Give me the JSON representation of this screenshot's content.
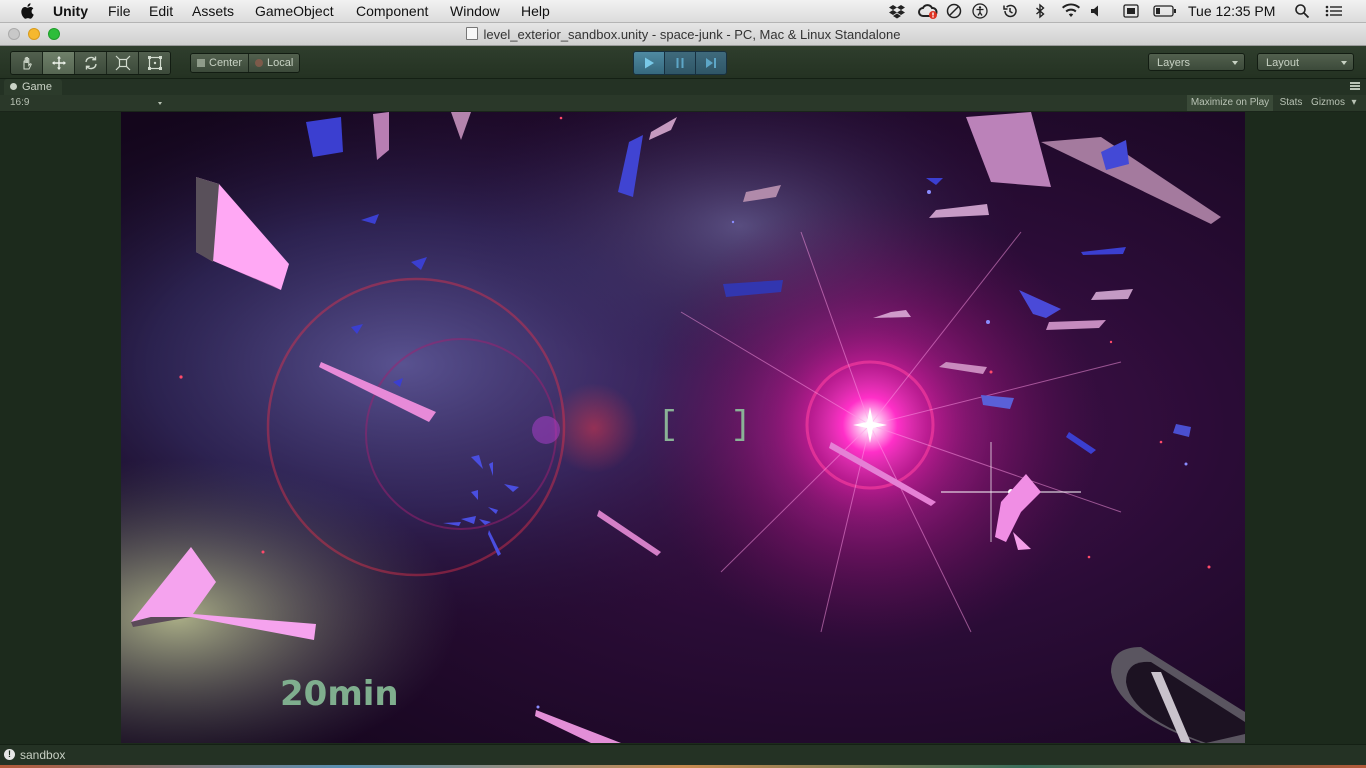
{
  "menubar": {
    "app_name": "Unity",
    "items": [
      "File",
      "Edit",
      "Assets",
      "GameObject",
      "Component",
      "Window",
      "Help"
    ],
    "status_icons": [
      "dropbox-icon",
      "creative-cloud-icon",
      "do-not-disturb-icon",
      "accessibility-icon",
      "time-machine-icon",
      "bluetooth-icon",
      "wifi-icon",
      "volume-icon",
      "input-source-icon",
      "battery-icon",
      "spotlight-search-icon",
      "notification-center-icon"
    ],
    "clock": "Tue 12:35 PM"
  },
  "window": {
    "title": "level_exterior_sandbox.unity - space-junk - PC, Mac & Linux Standalone"
  },
  "toolbar": {
    "transform_tools": [
      "hand-tool",
      "move-tool",
      "rotate-tool",
      "scale-tool",
      "rect-tool"
    ],
    "active_tool": "move-tool",
    "pivot_label": "Center",
    "space_label": "Local",
    "layers_label": "Layers",
    "layout_label": "Layout"
  },
  "game_panel": {
    "tab_label": "Game",
    "aspect": "16:9",
    "maximize_label": "Maximize on Play",
    "stats_label": "Stats",
    "gizmos_label": "Gizmos"
  },
  "hud": {
    "reticle": "[ ]",
    "timer": "20min"
  },
  "status": {
    "message": "sandbox"
  },
  "colors": {
    "unity_chrome": "#2f3e2d",
    "play_accent": "#3f6a7c",
    "hud_text": "#7fae8e",
    "shard_pink": "#f29ce8",
    "shard_blue": "#3b3fd0"
  }
}
